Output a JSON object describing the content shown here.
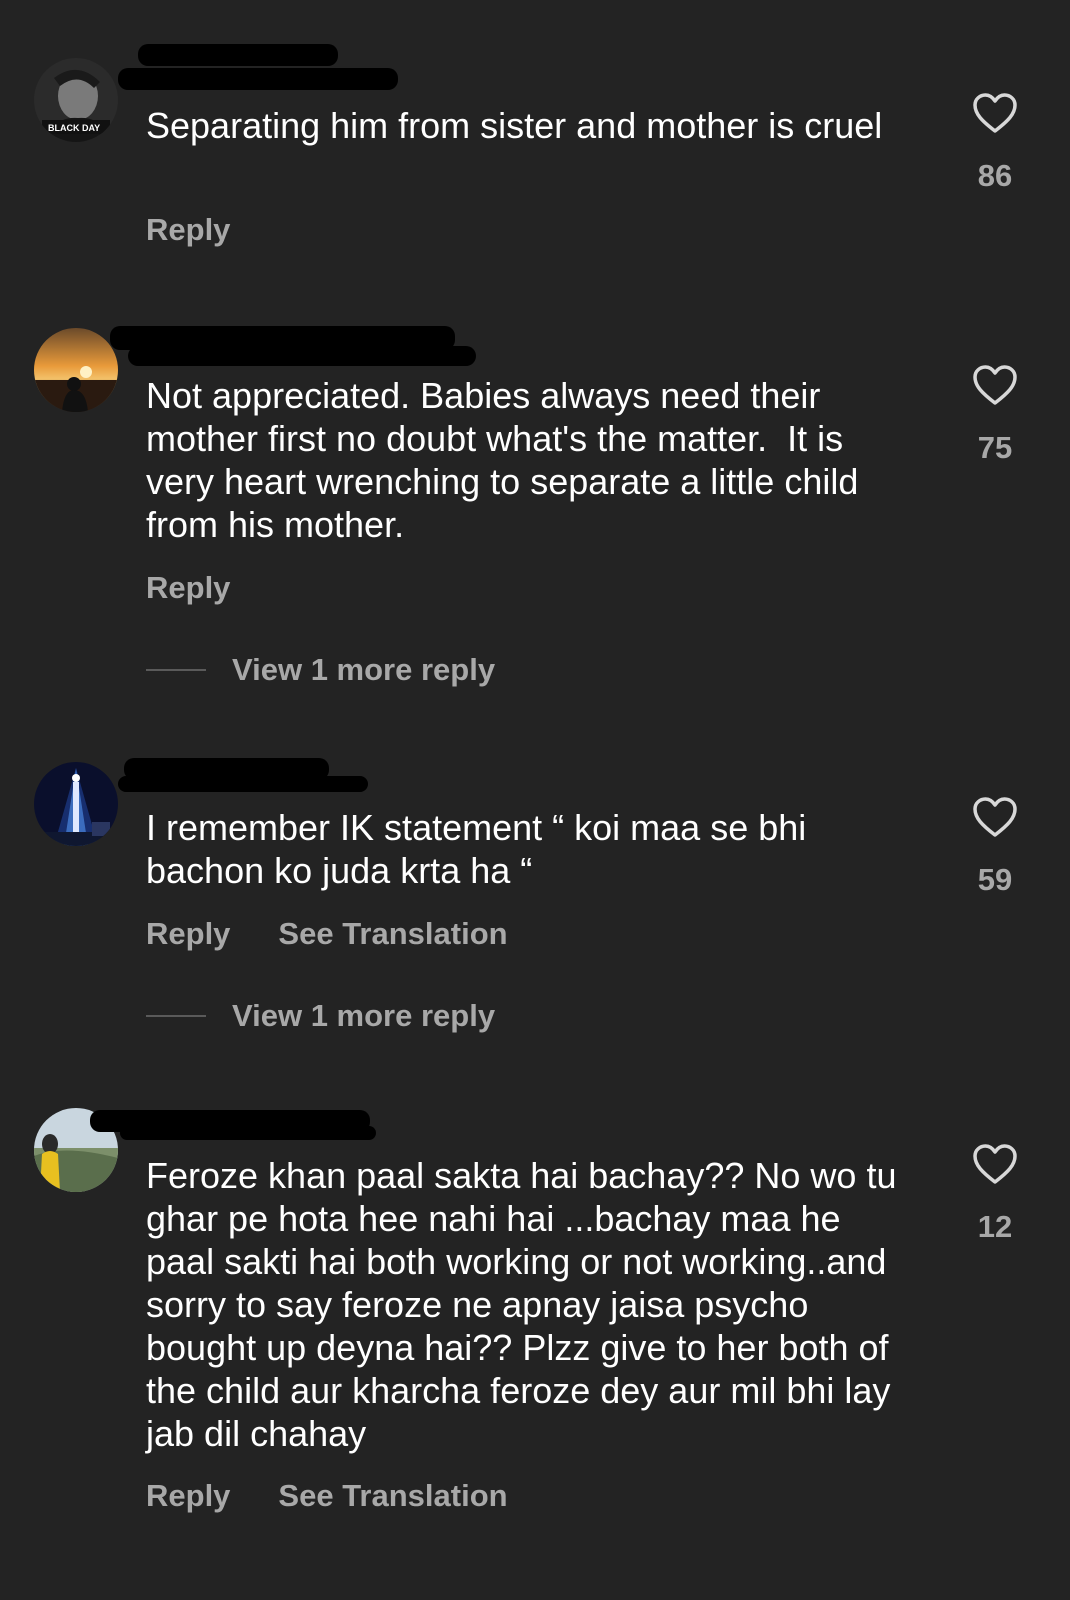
{
  "theme": {
    "background": "#232323",
    "text": "#ffffff",
    "muted": "#a8a8a8"
  },
  "comments": [
    {
      "avatar_icon": "black-day-avatar-icon",
      "avatar_text": "BLACK DAY",
      "text": "Separating him from sister and mother is cruel",
      "likes": "86",
      "actions": {
        "reply": "Reply"
      }
    },
    {
      "avatar_icon": "sunset-avatar-icon",
      "text": "Not appreciated. Babies always need their mother first no doubt what's the matter.  It is very heart wrenching to separate a little child from his mother.",
      "likes": "75",
      "actions": {
        "reply": "Reply"
      },
      "view_more": "View 1 more reply"
    },
    {
      "avatar_icon": "tower-lights-avatar-icon",
      "text": "I remember IK statement “ koi maa se bhi bachon ko juda krta ha “",
      "likes": "59",
      "actions": {
        "reply": "Reply",
        "translate": "See Translation"
      },
      "view_more": "View 1 more reply"
    },
    {
      "avatar_icon": "mountain-view-avatar-icon",
      "text": "Feroze khan paal sakta hai bachay?? No wo tu ghar pe hota hee nahi hai ...bachay maa he paal sakti hai both working or not working..and sorry to say feroze ne apnay jaisa psycho bought up deyna hai?? Plzz give to her both of the child aur kharcha feroze dey aur mil bhi lay jab dil chahay",
      "likes": "12",
      "actions": {
        "reply": "Reply",
        "translate": "See Translation"
      }
    }
  ]
}
